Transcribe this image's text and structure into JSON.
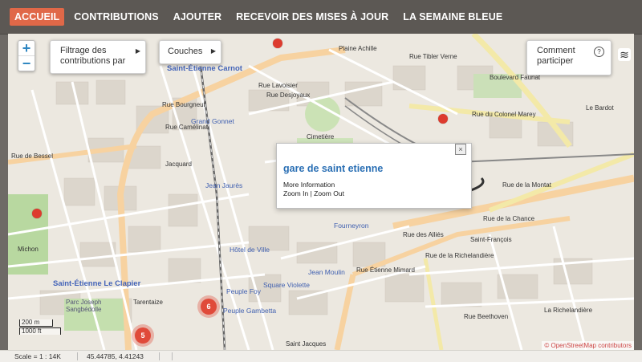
{
  "nav": {
    "tabs": [
      {
        "label": "ACCUEIL"
      },
      {
        "label": "CONTRIBUTIONS"
      },
      {
        "label": "AJOUTER"
      },
      {
        "label": "RECEVOIR DES MISES À JOUR"
      },
      {
        "label": "LA SEMAINE BLEUE"
      }
    ],
    "active_color": "#e06848"
  },
  "map_controls": {
    "zoom_in": "+",
    "zoom_out": "−",
    "filter_label": "Filtrage des contributions par",
    "layers_label": "Couches",
    "comment_label": "Comment participer",
    "help_icon": "?"
  },
  "popup": {
    "title": "gare de saint etienne",
    "more_info": "More Information",
    "zoom_in": "Zoom In",
    "zoom_out": "Zoom Out",
    "close": "×"
  },
  "clusters": [
    {
      "count": "6"
    },
    {
      "count": "5"
    }
  ],
  "scale": {
    "metric": "200 m",
    "imperial": "1000 ft"
  },
  "attribution": "© OpenStreetMap contributors",
  "status": {
    "scale_text": "Scale = 1 : 14K",
    "coords_text": "45.44785, 4.41243"
  },
  "map_labels": {
    "places": [
      "Saint-Étienne Carnot",
      "Saint-Étienne Le Clapier",
      "Grand Gonnet",
      "Jean Jaurès",
      "Hôtel de Ville",
      "Peuple Foy",
      "Peuple Gambetta",
      "Square Violette",
      "Jean Moulin",
      "Fourneyron",
      "Cimetière"
    ],
    "streets": [
      "Rue du Colonel Marey",
      "Rue de la Montat",
      "Rue des Alliés",
      "Rue Étienne Mimard",
      "Rue de la Richelandière",
      "Rue de la Chance",
      "Boulevard Fauriat",
      "Rue Tibler Verne",
      "Plaine Achille",
      "Le Bardot",
      "Rue Bourgneuf",
      "Rue Camélinat",
      "Rue Lavoisier",
      "Rue Desjoyaux",
      "Rue de Bessel",
      "Michon",
      "Rue Beethoven",
      "La Richelandière",
      "Saint-François",
      "Jacquard",
      "Tarentaize",
      "Saint Jacques",
      "Parc Joseph Sangbédolle"
    ]
  },
  "colors": {
    "marker": "#dd3b2e",
    "popup_title": "#2a6fb4",
    "topbar": "#5c5854"
  }
}
